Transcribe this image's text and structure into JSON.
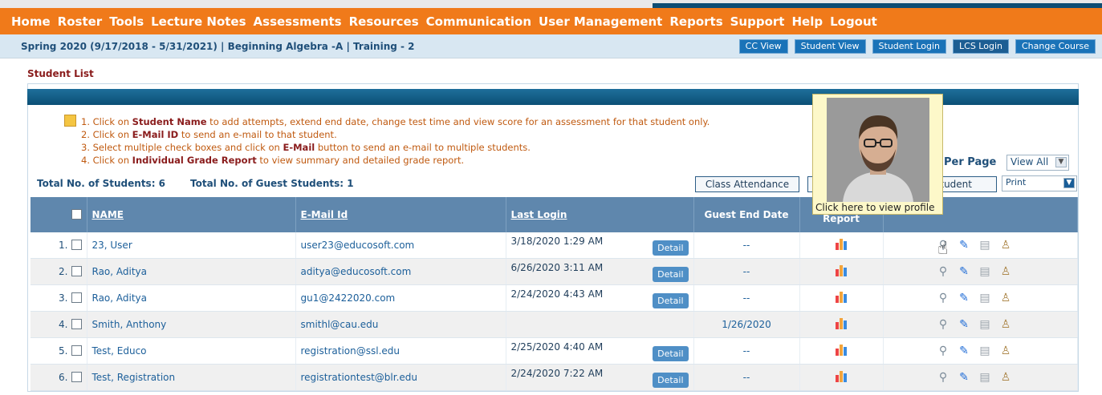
{
  "nav": [
    "Home",
    "Roster",
    "Tools",
    "Lecture Notes",
    "Assessments",
    "Resources",
    "Communication",
    "User Management",
    "Reports",
    "Support",
    "Help",
    "Logout"
  ],
  "breadcrumb": "Spring 2020 (9/17/2018 - 5/31/2021) | Beginning Algebra -A | Training - 2",
  "sub_buttons": [
    "CC View",
    "Student View",
    "Student Login",
    "LCS Login",
    "Change Course"
  ],
  "page_title": "Student List",
  "instructions": {
    "i1_pre": "1. Click on ",
    "i1_bold": "Student Name",
    "i1_post": " to add attempts, extend end date, change test time and view score for an assessment for that student only.",
    "i2_pre": "2. Click on ",
    "i2_bold": "E-Mail ID",
    "i2_post": " to send an e-mail to that student.",
    "i3_pre": "3. Select multiple check boxes and click on ",
    "i3_bold": "E-Mail",
    "i3_post": " button to send an e-mail to multiple students.",
    "i4_pre": "4. Click on ",
    "i4_bold": "Individual Grade Report",
    "i4_post": " to view summary and detailed grade report."
  },
  "totals": {
    "students": "Total No. of Students: 6",
    "guests": "Total No. of Guest Students: 1"
  },
  "per_page": {
    "label": "Per Page",
    "value": "View All"
  },
  "buttons": {
    "class_attendance": "Class Attendance",
    "student": "tudent",
    "print": "Print"
  },
  "table": {
    "headers": {
      "name": "NAME",
      "email": "E-Mail Id",
      "last_login": "Last Login",
      "guest_end": "Guest End Date",
      "report": "Report"
    },
    "detail_label": "Detail",
    "rows": [
      {
        "no": "1.",
        "name": "23, User",
        "email": "user23@educosoft.com",
        "last_login": "3/18/2020 1:29 AM",
        "detail": true,
        "guest_end": "--"
      },
      {
        "no": "2.",
        "name": "Rao, Aditya",
        "email": "aditya@educosoft.com",
        "last_login": "6/26/2020 3:11 AM",
        "detail": true,
        "guest_end": "--"
      },
      {
        "no": "3.",
        "name": "Rao, Aditya",
        "email": "gu1@2422020.com",
        "last_login": "2/24/2020 4:43 AM",
        "detail": true,
        "guest_end": "--"
      },
      {
        "no": "4.",
        "name": "Smith, Anthony",
        "email": "smithl@cau.edu",
        "last_login": "",
        "detail": false,
        "guest_end": "1/26/2020"
      },
      {
        "no": "5.",
        "name": "Test, Educo",
        "email": "registration@ssl.edu",
        "last_login": "2/25/2020 4:40 AM",
        "detail": true,
        "guest_end": "--"
      },
      {
        "no": "6.",
        "name": "Test, Registration",
        "email": "registrationtest@blr.edu",
        "last_login": "2/24/2020 7:22 AM",
        "detail": true,
        "guest_end": "--"
      }
    ]
  },
  "tooltip": "Click here to view profile",
  "colors": {
    "nav": "#f07a1a",
    "header": "#5f87ad",
    "link": "#1c5f9a",
    "accent": "#8a1c1c"
  }
}
